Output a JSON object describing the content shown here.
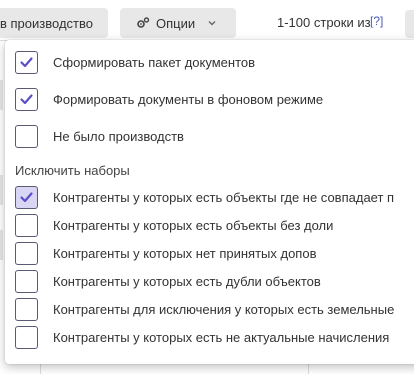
{
  "toolbar": {
    "production_label": "в производство",
    "options_label": "Опции",
    "rows_info": "1-100 строки из",
    "help_link": "[?]"
  },
  "dropdown": {
    "options": [
      {
        "label": "Сформировать пакет документов",
        "checked": true
      },
      {
        "label": "Формировать документы в фоновом режиме",
        "checked": true
      },
      {
        "label": "Не было производств",
        "checked": false
      }
    ],
    "exclude_section_title": "Исключить наборы",
    "exclude_options": [
      {
        "label": "Контрагенты у которых есть объекты где не совпадает п",
        "checked": true
      },
      {
        "label": "Контрагенты у которых есть объекты без доли",
        "checked": false
      },
      {
        "label": "Контрагенты у которых нет принятых допов",
        "checked": false
      },
      {
        "label": "Контрагенты у которых есть дубли объектов",
        "checked": false
      },
      {
        "label": "Контрагенты для исключения у которых есть земельные",
        "checked": false
      },
      {
        "label": "Контрагенты у которых есть не актуальные начисления",
        "checked": false
      }
    ]
  },
  "colors": {
    "checkmark": "#5b4fc7",
    "checked_bg_muted": "#d9d6f5",
    "toolbar_button": "#e8e8e8",
    "help_link": "#4a5bb0"
  }
}
